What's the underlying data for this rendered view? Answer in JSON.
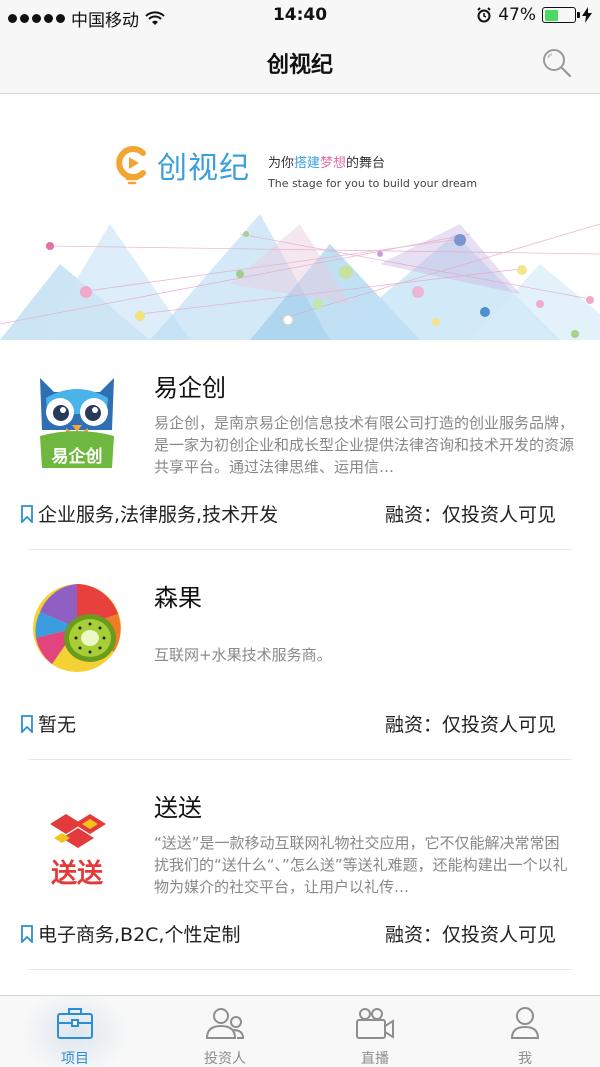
{
  "status_bar": {
    "carrier": "中国移动",
    "time": "14:40",
    "battery": "47%",
    "battery_level": 0.47
  },
  "nav": {
    "title": "创视纪"
  },
  "banner": {
    "brand_name": "创视纪",
    "slogan_cn_prefix": "为你",
    "slogan_cn_hl1": "搭建",
    "slogan_cn_hl2": "梦想",
    "slogan_cn_suffix": "的舞台",
    "slogan_en": "The stage for you to build your dream"
  },
  "projects": [
    {
      "name": "易企创",
      "logo_text": "易企创",
      "description": "易企创，是南京易企创信息技术有限公司打造的创业服务品牌，是一家为初创企业和成长型企业提供法律咨询和技术开发的资源共享平台。通过法律思维、运用信…",
      "tags": "企业服务,法律服务,技术开发",
      "financing": "融资：仅投资人可见"
    },
    {
      "name": "森果",
      "description": "互联网+水果技术服务商。",
      "tags": "暂无",
      "financing": "融资：仅投资人可见"
    },
    {
      "name": "送送",
      "logo_text": "送送",
      "description": "“送送”是一款移动互联网礼物社交应用，它不仅能解决常常困扰我们的“送什么“、”怎么送”等送礼难题，还能构建出一个以礼物为媒介的社交平台，让用户以礼传…",
      "tags": "电子商务,B2C,个性定制",
      "financing": "融资：仅投资人可见"
    }
  ],
  "tabs": [
    {
      "label": "项目",
      "icon": "briefcase-icon",
      "active": true
    },
    {
      "label": "投资人",
      "icon": "people-icon",
      "active": false
    },
    {
      "label": "直播",
      "icon": "video-camera-icon",
      "active": false
    },
    {
      "label": "我",
      "icon": "person-icon",
      "active": false
    }
  ],
  "colors": {
    "accent": "#2a8fd6",
    "brand_blue": "#3aa0dc",
    "brand_pink": "#e56fa5",
    "battery_green": "#4cd964"
  }
}
